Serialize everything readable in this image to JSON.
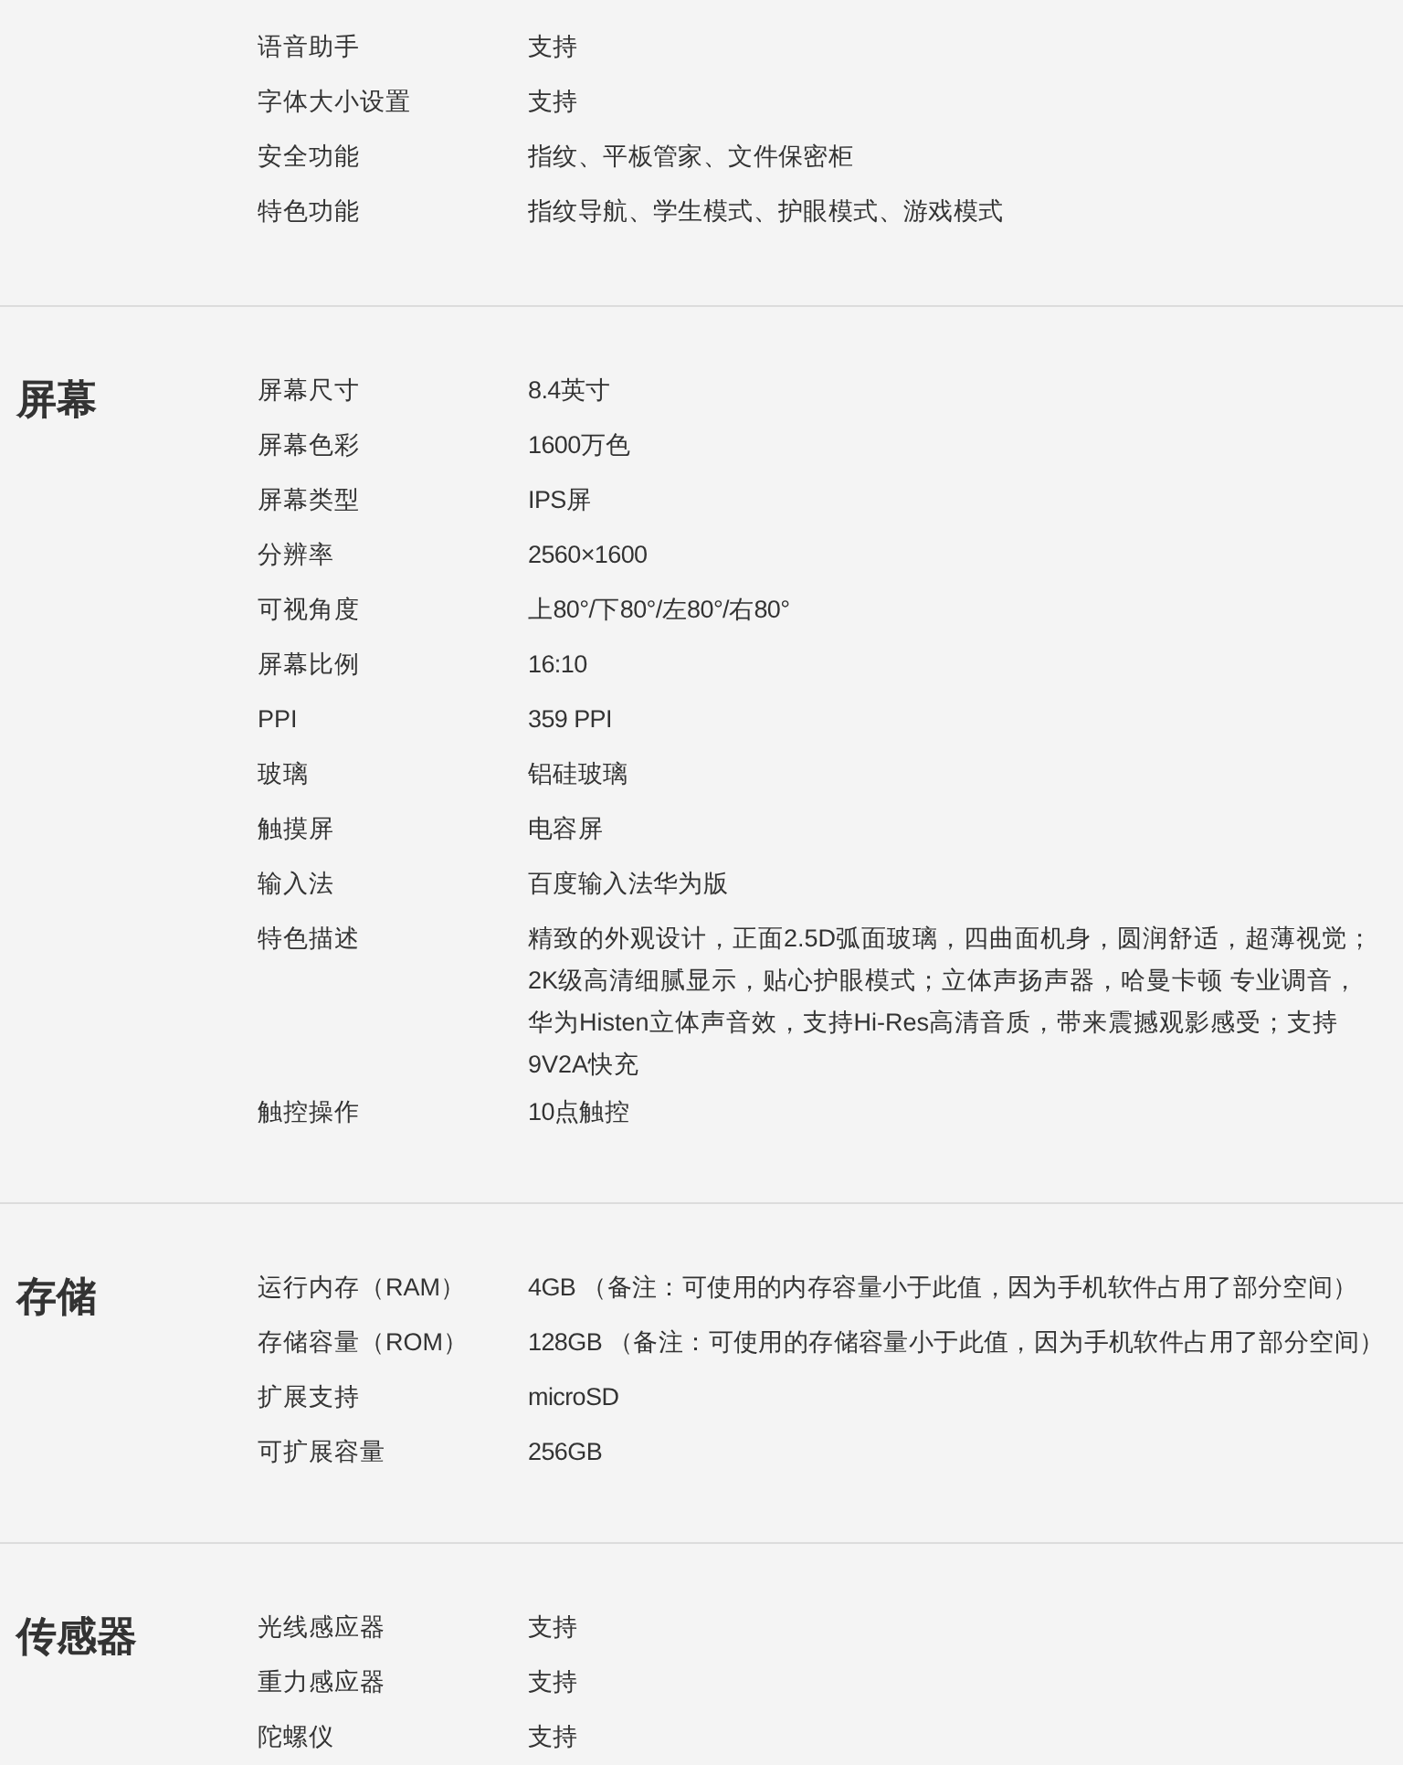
{
  "sections": [
    {
      "rows": [
        {
          "label": "语音助手",
          "value": "支持"
        },
        {
          "label": "字体大小设置",
          "value": "支持"
        },
        {
          "label": "安全功能",
          "value": "指纹、平板管家、文件保密柜"
        },
        {
          "label": "特色功能",
          "value": "指纹导航、学生模式、护眼模式、游戏模式"
        }
      ]
    },
    {
      "title": "屏幕",
      "rows": [
        {
          "label": "屏幕尺寸",
          "value": "8.4英寸"
        },
        {
          "label": "屏幕色彩",
          "value": "1600万色"
        },
        {
          "label": "屏幕类型",
          "value": "IPS屏"
        },
        {
          "label": "分辨率",
          "value": "2560×1600"
        },
        {
          "label": "可视角度",
          "value": "上80°/下80°/左80°/右80°"
        },
        {
          "label": "屏幕比例",
          "value": "16:10"
        },
        {
          "label": "PPI",
          "value": "359 PPI"
        },
        {
          "label": "玻璃",
          "value": "铝硅玻璃"
        },
        {
          "label": "触摸屏",
          "value": "电容屏"
        },
        {
          "label": "输入法",
          "value": "百度输入法华为版"
        },
        {
          "label": "特色描述",
          "value": "精致的外观设计，正面2.5D弧面玻璃，四曲面机身，圆润舒适，超薄视觉；2K级高清细腻显示，贴心护眼模式；立体声扬声器，哈曼卡顿 专业调音，华为Histen立体声音效，支持Hi-Res高清音质，带来震撼观影感受；支持 9V2A快充"
        },
        {
          "label": "触控操作",
          "value": "10点触控"
        }
      ]
    },
    {
      "title": "存储",
      "rows": [
        {
          "label": "运行内存（RAM）",
          "value": "4GB （备注：可使用的内存容量小于此值，因为手机软件占用了部分空间）"
        },
        {
          "label": "存储容量（ROM）",
          "value": "128GB （备注：可使用的存储容量小于此值，因为手机软件占用了部分空间）"
        },
        {
          "label": "扩展支持",
          "value": "microSD"
        },
        {
          "label": "可扩展容量",
          "value": "256GB"
        }
      ]
    },
    {
      "title": "传感器",
      "rows": [
        {
          "label": "光线感应器",
          "value": "支持"
        },
        {
          "label": "重力感应器",
          "value": "支持"
        },
        {
          "label": "陀螺仪",
          "value": "支持"
        }
      ]
    }
  ]
}
